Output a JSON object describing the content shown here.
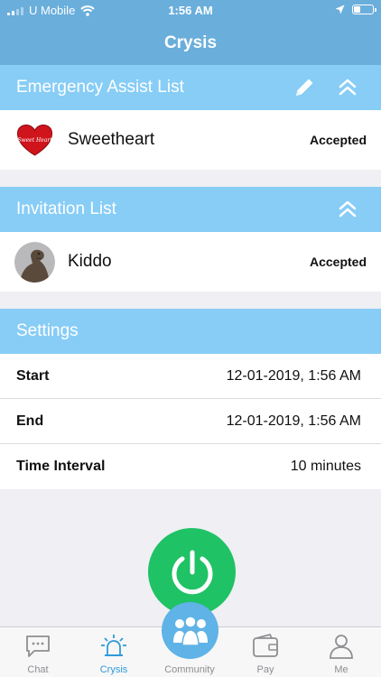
{
  "status_bar": {
    "carrier": "U Mobile",
    "time": "1:56 AM"
  },
  "nav": {
    "title": "Crysis"
  },
  "emergency": {
    "title": "Emergency Assist List",
    "contacts": [
      {
        "name": "Sweetheart",
        "status": "Accepted",
        "avatar_text": "Sweet Heart"
      }
    ]
  },
  "invitation": {
    "title": "Invitation List",
    "contacts": [
      {
        "name": "Kiddo",
        "status": "Accepted"
      }
    ]
  },
  "settings": {
    "title": "Settings",
    "rows": [
      {
        "label": "Start",
        "value": "12-01-2019, 1:56 AM"
      },
      {
        "label": "End",
        "value": "12-01-2019, 1:56 AM"
      },
      {
        "label": "Time Interval",
        "value": "10 minutes"
      }
    ]
  },
  "tabs": [
    {
      "label": "Chat",
      "icon": "chat-icon",
      "active": false
    },
    {
      "label": "Crysis",
      "icon": "siren-icon",
      "active": true
    },
    {
      "label": "Community",
      "icon": "community-icon",
      "active": false
    },
    {
      "label": "Pay",
      "icon": "wallet-icon",
      "active": false
    },
    {
      "label": "Me",
      "icon": "person-icon",
      "active": false
    }
  ],
  "colors": {
    "primary": "#6aaedb",
    "section_header": "#87cdf6",
    "power_button": "#1fc264",
    "active_tab": "#2f9ad8",
    "inactive_tab": "#8e8e93",
    "background": "#efeff4"
  }
}
